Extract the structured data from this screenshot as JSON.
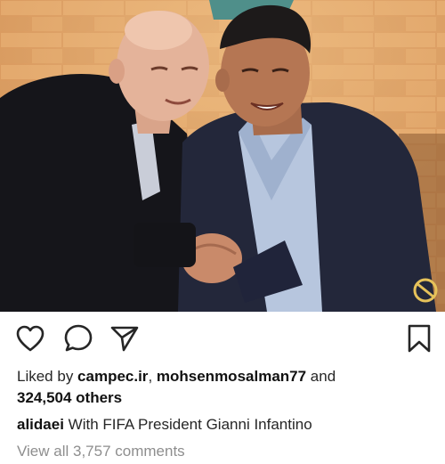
{
  "post": {
    "photo_alt": "",
    "actions": {
      "like_icon": "heart-outline-icon",
      "comment_icon": "speech-bubble-icon",
      "share_icon": "paper-plane-icon",
      "save_icon": "bookmark-outline-icon"
    },
    "likes": {
      "prefix": "Liked by ",
      "user1": "campec.ir",
      "separator": ", ",
      "user2": "mohsenmosalman77",
      "and": " and",
      "count": "324,504 others"
    },
    "caption": {
      "username": "alidaei",
      "text": " With FIFA President Gianni Infantino"
    },
    "view_comments": "View all 3,757 comments"
  },
  "colors": {
    "text": "#262626",
    "muted": "#8e8e8e",
    "background": "#ffffff"
  }
}
